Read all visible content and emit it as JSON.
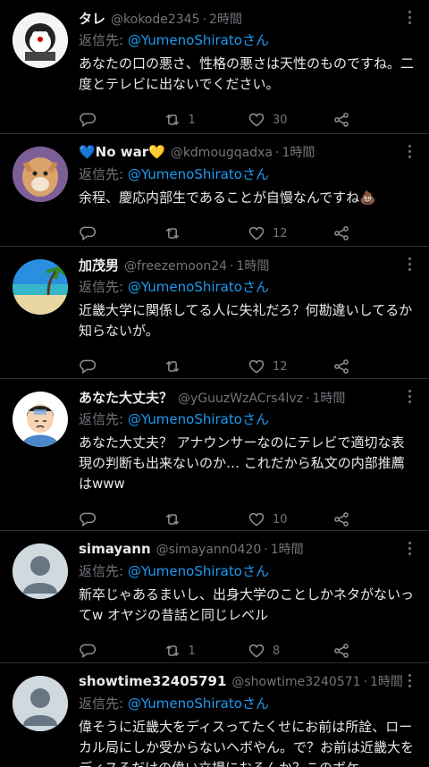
{
  "reply_prefix": "返信先:",
  "reply_to": "@YumenoShirato",
  "reply_suffix": "さん",
  "tweets": [
    {
      "name": "タレ",
      "handle": "@kokode2345",
      "time": "2時間",
      "text": "あなたの口の悪さ、性格の悪さは天性のものですね。二度とテレビに出ないでください。",
      "retweets": "1",
      "likes": "30"
    },
    {
      "name": "💙No war💛",
      "handle": "@kdmougqadxa",
      "time": "1時間",
      "text": "余程、慶応内部生であることが自慢なんですね💩",
      "retweets": "",
      "likes": "12"
    },
    {
      "name": "加茂男",
      "handle": "@freezemoon24",
      "time": "1時間",
      "text": "近畿大学に関係してる人に失礼だろ？何勘違いしてるか知らないが。",
      "retweets": "",
      "likes": "12"
    },
    {
      "name": "あなた大丈夫？",
      "handle": "@yGuuzWzACrs4lvz",
      "time": "1時間",
      "text": "あなた大丈夫？ アナウンサーなのにテレビで適切な表現の判断も出来ないのか… これだから私文の内部推薦はwww",
      "retweets": "",
      "likes": "10"
    },
    {
      "name": "simayann",
      "handle": "@simayann0420",
      "time": "1時間",
      "text": "新卒じゃあるまいし、出身大学のことしかネタがないってw オヤジの昔話と同じレベル",
      "retweets": "1",
      "likes": "8"
    },
    {
      "name": "showtime32405791",
      "handle": "@showtime3240571",
      "time": "1時間",
      "text": "偉そうに近畿大をディスってたくせにお前は所詮、ローカル局にしか受からないヘボやん。で？お前は近畿大をディスるだけの偉い立場におるんか？このボケ。",
      "retweets": "",
      "likes": ""
    }
  ]
}
